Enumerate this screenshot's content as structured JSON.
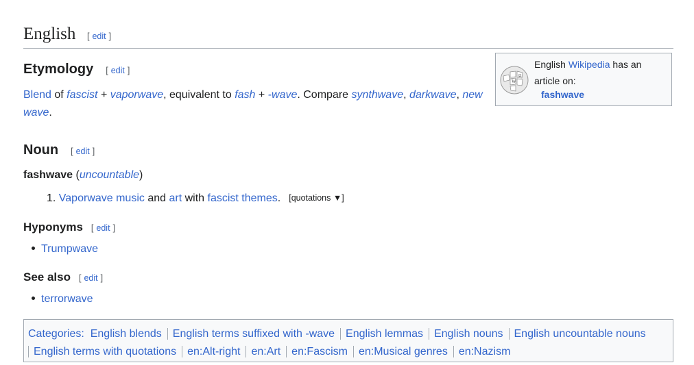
{
  "lang_heading": {
    "title": "English",
    "edit_open": "[",
    "edit": "edit",
    "edit_close": "]"
  },
  "etymology": {
    "heading": "Etymology",
    "text": {
      "w1": "Blend",
      "w2": " of ",
      "w3": "fascist",
      "w4": " + ",
      "w5": "vaporwave",
      "w6": ", equivalent to ",
      "w7": "fash",
      "w8": " + ",
      "w9": "-wave",
      "w10": ". Compare ",
      "w11": "synthwave",
      "w12": ", ",
      "w13": "darkwave",
      "w14": ", ",
      "w15": "new wave",
      "w16": "."
    }
  },
  "wikipedia_box": {
    "pre": "English ",
    "link": "Wikipedia",
    "post": " has an article on:",
    "article": "fashwave"
  },
  "noun": {
    "heading": "Noun",
    "headword": "fashwave",
    "paren_open": " (",
    "label": "uncountable",
    "paren_close": ")",
    "sense": {
      "number": "1.",
      "s1": "Vaporwave music",
      "s2": " and ",
      "s3": "art",
      "s4": " with ",
      "s5": "fascist themes",
      "s6": ".",
      "quotations": "[quotations ▼]"
    }
  },
  "hyponyms": {
    "heading": "Hyponyms",
    "items": [
      "Trumpwave"
    ]
  },
  "see_also": {
    "heading": "See also",
    "items": [
      "terrorwave"
    ]
  },
  "edit_label": "edit",
  "categories": {
    "label": "Categories:",
    "items": [
      "English blends",
      "English terms suffixed with -wave",
      "English lemmas",
      "English nouns",
      "English uncountable nouns",
      "English terms with quotations",
      "en:Alt-right",
      "en:Art",
      "en:Fascism",
      "en:Musical genres",
      "en:Nazism"
    ]
  },
  "colors": {
    "link": "#3366cc",
    "text": "#202122",
    "border": "#a2a9b1",
    "box_bg": "#f8f9fa"
  }
}
